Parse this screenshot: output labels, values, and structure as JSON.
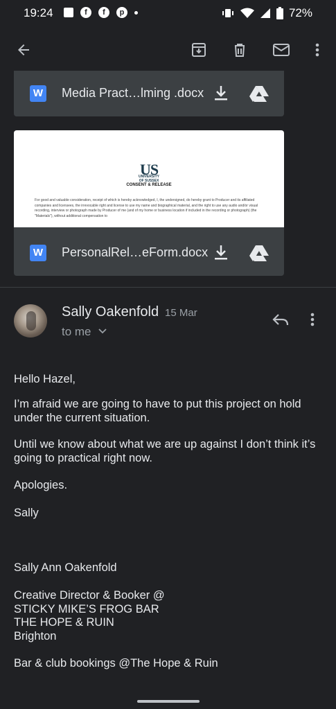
{
  "status_bar": {
    "time": "19:24",
    "battery": "72%"
  },
  "toolbar": {
    "icons": [
      "back-arrow-icon",
      "archive-icon",
      "delete-icon",
      "mark-unread-icon",
      "more-vert-icon"
    ]
  },
  "attachments": [
    {
      "type_letter": "W",
      "name": "Media Pract…lming .docx"
    },
    {
      "type_letter": "W",
      "name": "PersonalRel…eForm.docx"
    }
  ],
  "preview": {
    "logo": "US",
    "university": "UNIVERSITY",
    "of_sussex": "OF SUSSEX",
    "title": "CONSENT & RELEASE",
    "body": "For good and valuable consideration, receipt of which is hereby acknowledged, I, the undersigned, do hereby grant to Producer and its affiliated companies and licensees, the irrevocable right and license to use my name and biographical material, and the right to use any audio and/or visual recording, interview or photograph made by Producer of me (and of my home or business location if included in the recording or photograph) (the \"Materials\"), without additional compensation to"
  },
  "email": {
    "sender": "Sally Oakenfold",
    "date": "15 Mar",
    "recipient": "to me",
    "greeting": "Hello Hazel,",
    "para1": "I’m afraid we are going to have to put this project on hold under the current situation.",
    "para2": "Until we know about what we are up against I don’t think it’s going to practical right now.",
    "para3": "Apologies.",
    "signoff": "Sally",
    "sig_name": "Sally Ann Oakenfold",
    "sig_role": "Creative Director & Booker @",
    "sig_venue1": "STICKY MIKE’S FROG BAR",
    "sig_venue2": "THE HOPE & RUIN",
    "sig_city": "Brighton",
    "sig_bookings": "Bar & club bookings @The Hope & Ruin"
  }
}
